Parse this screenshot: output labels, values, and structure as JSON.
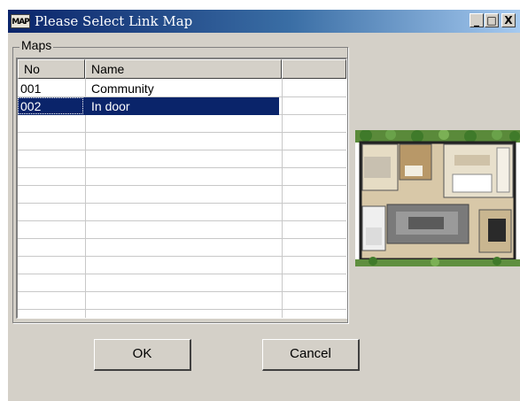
{
  "window": {
    "icon_text": "MAP",
    "title": "Please Select Link Map",
    "minimize": "_",
    "maximize": "□",
    "close": "X"
  },
  "group": {
    "label": "Maps"
  },
  "list": {
    "columns": [
      "No",
      "Name"
    ],
    "rows": [
      {
        "no": "001",
        "name": "Community",
        "selected": false
      },
      {
        "no": "002",
        "name": "In door",
        "selected": true
      }
    ]
  },
  "preview": {
    "icon": "floor-plan-thumbnail"
  },
  "buttons": {
    "ok": "OK",
    "cancel": "Cancel"
  }
}
